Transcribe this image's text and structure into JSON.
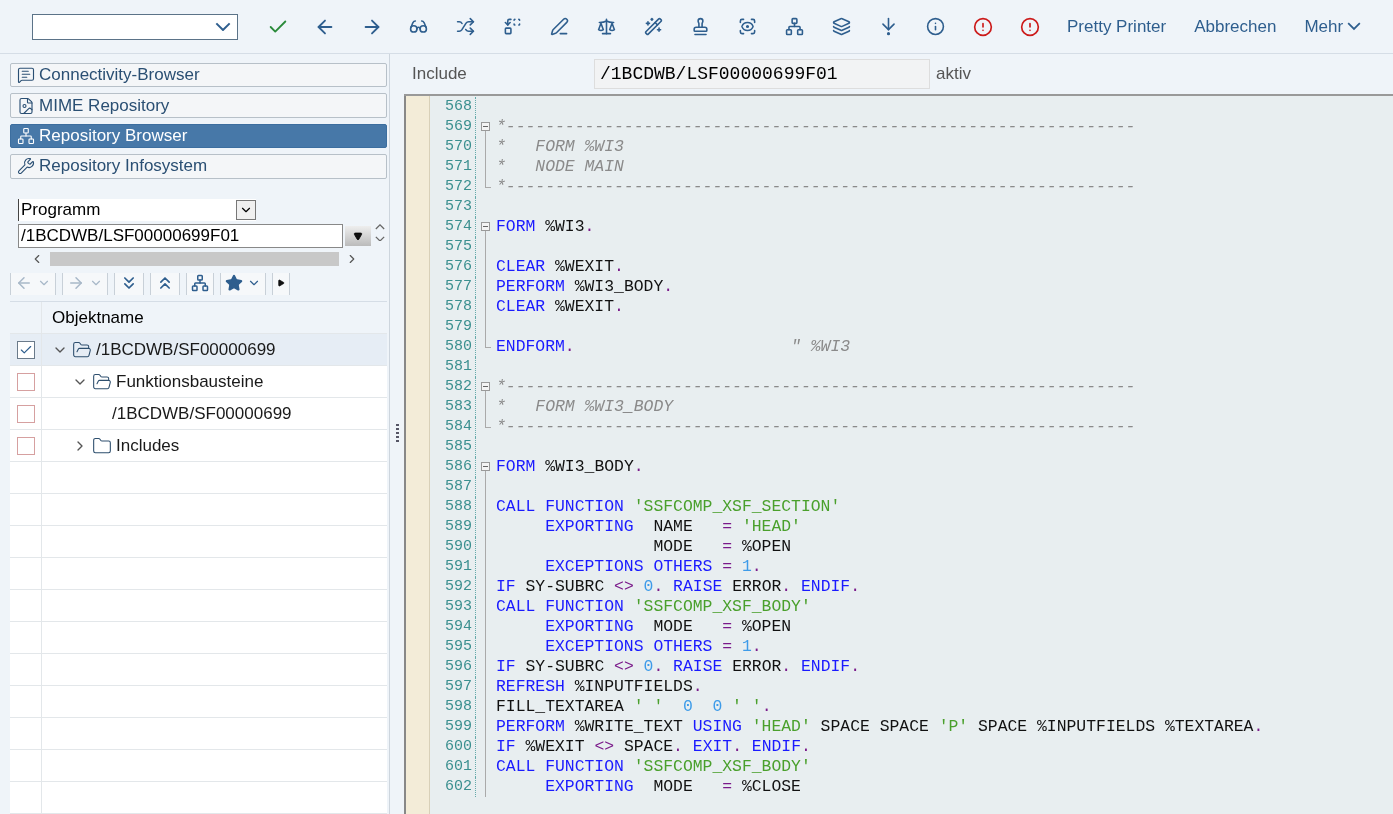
{
  "toolbar": {
    "text_buttons": [
      {
        "label": "Pretty Printer",
        "kind": "plain"
      },
      {
        "label": "Abbrechen",
        "kind": "plain"
      },
      {
        "label": "Mehr",
        "kind": "menu"
      }
    ]
  },
  "navigator": {
    "buttons": [
      {
        "label": "Connectivity-Browser",
        "selected": false
      },
      {
        "label": "MIME Repository",
        "selected": false
      },
      {
        "label": "Repository Browser",
        "selected": true
      },
      {
        "label": "Repository Infosystem",
        "selected": false
      }
    ],
    "object_type": {
      "value": "Programm"
    },
    "object_name": {
      "value": "/1BCDWB/LSF00000699F01"
    },
    "column_header": "Objektname",
    "tree": [
      {
        "label": "/1BCDWB/SF00000699",
        "expanded": true,
        "checked": true,
        "selected": true,
        "children": [
          {
            "label": "Funktionsbausteine",
            "expanded": true,
            "checked": false,
            "selected": false,
            "children": [
              {
                "label": "/1BCDWB/SF00000699",
                "checked": false,
                "selected": false
              }
            ]
          },
          {
            "label": "Includes",
            "expanded": false,
            "checked": false,
            "selected": false
          }
        ]
      }
    ]
  },
  "editor": {
    "object_label": "Include",
    "object_value": "/1BCDWB/LSF00000699F01",
    "status": "aktiv",
    "lines": [
      {
        "no": "568"
      },
      {
        "no": "569",
        "fold_start": true,
        "tokens": [
          {
            "comment": "*----------------------------------------------------------------"
          }
        ]
      },
      {
        "no": "570",
        "in_fold": true,
        "tokens": [
          {
            "comment": "*   FORM %WI3"
          }
        ]
      },
      {
        "no": "571",
        "in_fold": true,
        "tokens": [
          {
            "comment": "*   NODE MAIN"
          }
        ]
      },
      {
        "no": "572",
        "fold_end": true,
        "tokens": [
          {
            "comment": "*----------------------------------------------------------------"
          }
        ]
      },
      {
        "no": "573"
      },
      {
        "no": "574",
        "fold_start": true,
        "tokens": [
          {
            "keyword": "FORM"
          },
          {
            "text": " %WI3"
          },
          {
            "operator": "."
          }
        ]
      },
      {
        "no": "575",
        "in_fold": true
      },
      {
        "no": "576",
        "in_fold": true,
        "tokens": [
          {
            "keyword": "CLEAR"
          },
          {
            "text": " %WEXIT"
          },
          {
            "operator": "."
          }
        ]
      },
      {
        "no": "577",
        "in_fold": true,
        "tokens": [
          {
            "keyword": "PERFORM"
          },
          {
            "text": " %WI3_BODY"
          },
          {
            "operator": "."
          }
        ]
      },
      {
        "no": "578",
        "in_fold": true,
        "tokens": [
          {
            "keyword": "CLEAR"
          },
          {
            "text": " %WEXIT"
          },
          {
            "operator": "."
          }
        ]
      },
      {
        "no": "579",
        "in_fold": true
      },
      {
        "no": "580",
        "fold_end": true,
        "tokens": [
          {
            "keyword": "ENDFORM"
          },
          {
            "operator": "."
          },
          {
            "comment": "                      \" %WI3"
          }
        ]
      },
      {
        "no": "581"
      },
      {
        "no": "582",
        "fold_start": true,
        "tokens": [
          {
            "comment": "*----------------------------------------------------------------"
          }
        ]
      },
      {
        "no": "583",
        "in_fold": true,
        "tokens": [
          {
            "comment": "*   FORM %WI3_BODY"
          }
        ]
      },
      {
        "no": "584",
        "fold_end": true,
        "tokens": [
          {
            "comment": "*----------------------------------------------------------------"
          }
        ]
      },
      {
        "no": "585"
      },
      {
        "no": "586",
        "fold_start": true,
        "tokens": [
          {
            "keyword": "FORM"
          },
          {
            "text": " %WI3_BODY"
          },
          {
            "operator": "."
          }
        ]
      },
      {
        "no": "587",
        "in_fold": true
      },
      {
        "no": "588",
        "in_fold": true,
        "tokens": [
          {
            "keyword": "CALL FUNCTION"
          },
          {
            "string": " 'SSFCOMP_XSF_SECTION'"
          }
        ]
      },
      {
        "no": "589",
        "in_fold": true,
        "tokens": [
          {
            "keyword": "     EXPORTING"
          },
          {
            "text": "  NAME   "
          },
          {
            "operator": "="
          },
          {
            "string": " 'HEAD'"
          }
        ]
      },
      {
        "no": "590",
        "in_fold": true,
        "tokens": [
          {
            "text": "                MODE   "
          },
          {
            "operator": "="
          },
          {
            "text": " %OPEN"
          }
        ]
      },
      {
        "no": "591",
        "in_fold": true,
        "tokens": [
          {
            "keyword": "     EXCEPTIONS OTHERS"
          },
          {
            "operator": " ="
          },
          {
            "number": " 1"
          },
          {
            "operator": "."
          }
        ]
      },
      {
        "no": "592",
        "in_fold": true,
        "tokens": [
          {
            "keyword": "IF"
          },
          {
            "text": " SY-SUBRC "
          },
          {
            "operator": "<>"
          },
          {
            "number": " 0"
          },
          {
            "operator": "."
          },
          {
            "keyword": " RAISE"
          },
          {
            "text": " ERROR"
          },
          {
            "operator": "."
          },
          {
            "keyword": " ENDIF"
          },
          {
            "operator": "."
          }
        ]
      },
      {
        "no": "593",
        "in_fold": true,
        "tokens": [
          {
            "keyword": "CALL FUNCTION"
          },
          {
            "string": " 'SSFCOMP_XSF_BODY'"
          }
        ]
      },
      {
        "no": "594",
        "in_fold": true,
        "tokens": [
          {
            "keyword": "     EXPORTING"
          },
          {
            "text": "  MODE   "
          },
          {
            "operator": "="
          },
          {
            "text": " %OPEN"
          }
        ]
      },
      {
        "no": "595",
        "in_fold": true,
        "tokens": [
          {
            "keyword": "     EXCEPTIONS OTHERS"
          },
          {
            "operator": " ="
          },
          {
            "number": " 1"
          },
          {
            "operator": "."
          }
        ]
      },
      {
        "no": "596",
        "in_fold": true,
        "tokens": [
          {
            "keyword": "IF"
          },
          {
            "text": " SY-SUBRC "
          },
          {
            "operator": "<>"
          },
          {
            "number": " 0"
          },
          {
            "operator": "."
          },
          {
            "keyword": " RAISE"
          },
          {
            "text": " ERROR"
          },
          {
            "operator": "."
          },
          {
            "keyword": " ENDIF"
          },
          {
            "operator": "."
          }
        ]
      },
      {
        "no": "597",
        "in_fold": true,
        "tokens": [
          {
            "keyword": "REFRESH"
          },
          {
            "text": " %INPUTFIELDS"
          },
          {
            "operator": "."
          }
        ]
      },
      {
        "no": "598",
        "in_fold": true,
        "tokens": [
          {
            "text": "FILL_TEXTAREA "
          },
          {
            "string": "' '"
          },
          {
            "number": "  0  0"
          },
          {
            "string": " ' '"
          },
          {
            "operator": "."
          }
        ]
      },
      {
        "no": "599",
        "in_fold": true,
        "tokens": [
          {
            "keyword": "PERFORM"
          },
          {
            "text": " %WRITE_TEXT "
          },
          {
            "keyword": "USING"
          },
          {
            "string": " 'HEAD'"
          },
          {
            "text": " SPACE SPACE "
          },
          {
            "string": "'P'"
          },
          {
            "text": " SPACE %INPUTFIELDS %TEXTAREA"
          },
          {
            "operator": "."
          }
        ]
      },
      {
        "no": "600",
        "in_fold": true,
        "tokens": [
          {
            "keyword": "IF"
          },
          {
            "text": " %WEXIT "
          },
          {
            "operator": "<>"
          },
          {
            "text": " SPACE"
          },
          {
            "operator": "."
          },
          {
            "keyword": " EXIT"
          },
          {
            "operator": "."
          },
          {
            "keyword": " ENDIF"
          },
          {
            "operator": "."
          }
        ]
      },
      {
        "no": "601",
        "in_fold": true,
        "tokens": [
          {
            "keyword": "CALL FUNCTION"
          },
          {
            "string": " 'SSFCOMP_XSF_BODY'"
          }
        ]
      },
      {
        "no": "602",
        "in_fold": true,
        "tokens": [
          {
            "keyword": "     EXPORTING"
          },
          {
            "text": "  MODE   "
          },
          {
            "operator": "="
          },
          {
            "text": " %CLOSE"
          }
        ]
      }
    ]
  }
}
